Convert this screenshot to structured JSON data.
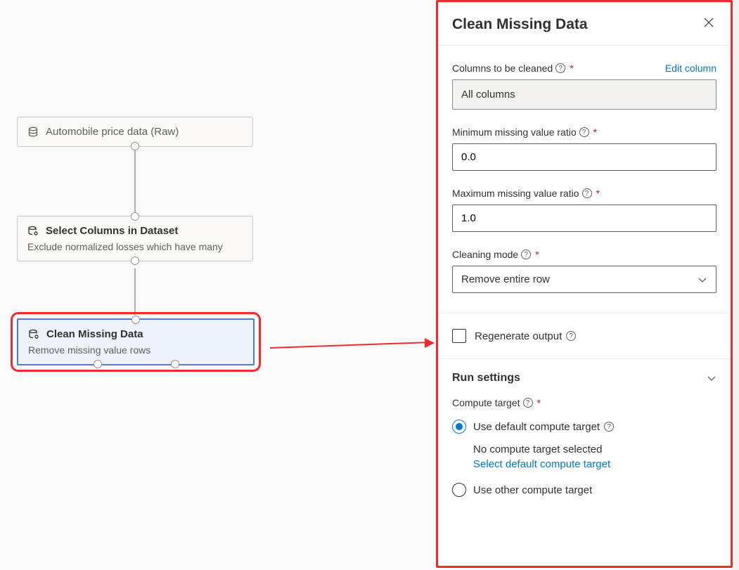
{
  "canvas": {
    "nodes": [
      {
        "title": "Automobile price data (Raw)",
        "subtitle": ""
      },
      {
        "title": "Select Columns in Dataset",
        "subtitle": "Exclude normalized losses which have many"
      },
      {
        "title": "Clean Missing Data",
        "subtitle": "Remove missing value rows"
      }
    ]
  },
  "panel": {
    "title": "Clean Missing Data",
    "columns_label": "Columns to be cleaned",
    "edit_column": "Edit column",
    "columns_value": "All columns",
    "min_label": "Minimum missing value ratio",
    "min_value": "0.0",
    "max_label": "Maximum missing value ratio",
    "max_value": "1.0",
    "mode_label": "Cleaning mode",
    "mode_value": "Remove entire row",
    "regen_label": "Regenerate output",
    "run_settings": "Run settings",
    "compute_label": "Compute target",
    "radio1": "Use default compute target",
    "radio1_sub1": "No compute target selected",
    "radio1_sub2": "Select default compute target",
    "radio2": "Use other compute target"
  }
}
